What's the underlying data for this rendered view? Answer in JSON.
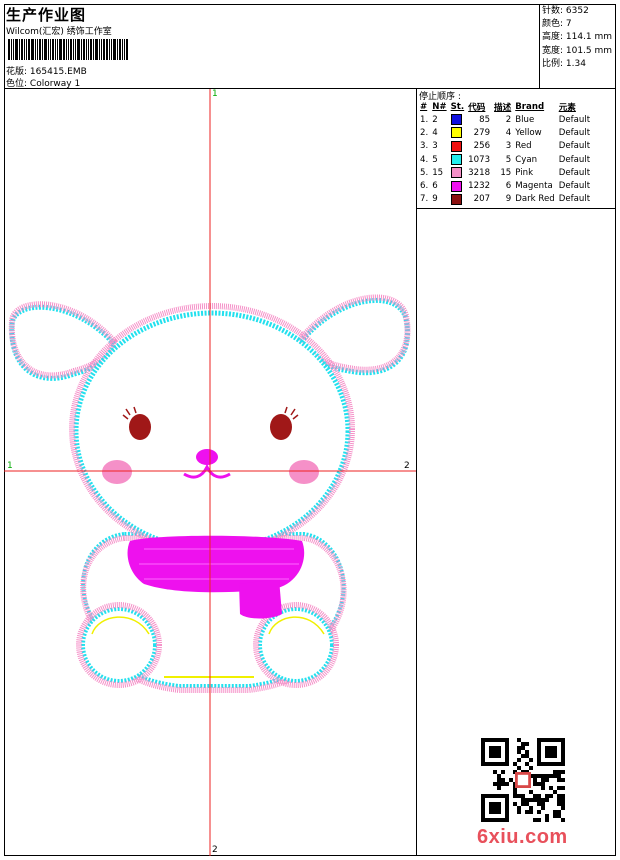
{
  "header": {
    "title": "生产作业图",
    "subtitle": "Wilcom(汇宏) 绣饰工作室",
    "design_label": "花版:",
    "design_value": "165415.EMB",
    "color_label": "色位:",
    "color_value": "Colorway 1"
  },
  "stats": {
    "stitches": "针数: 6352",
    "colors": "颜色: 7",
    "height": "高度: 114.1 mm",
    "width": "宽度: 101.5 mm",
    "scale": "比例: 1.34"
  },
  "sequence": {
    "heading": "停止顺序 :",
    "columns": [
      "#",
      "N#",
      "St.",
      "代码",
      "描述",
      "Brand",
      "元素"
    ],
    "rows": [
      {
        "idx": "1.",
        "n": "2",
        "color": "#1010e0",
        "st": "85",
        "code": "2",
        "desc": "Blue",
        "brand": "Default"
      },
      {
        "idx": "2.",
        "n": "4",
        "color": "#ffff00",
        "st": "279",
        "code": "4",
        "desc": "Yellow",
        "brand": "Default"
      },
      {
        "idx": "3.",
        "n": "3",
        "color": "#ee1111",
        "st": "256",
        "code": "3",
        "desc": "Red",
        "brand": "Default"
      },
      {
        "idx": "4.",
        "n": "5",
        "color": "#22eeee",
        "st": "1073",
        "code": "5",
        "desc": "Cyan",
        "brand": "Default"
      },
      {
        "idx": "5.",
        "n": "15",
        "color": "#f590c8",
        "st": "3218",
        "code": "15",
        "desc": "Pink",
        "brand": "Default"
      },
      {
        "idx": "6.",
        "n": "6",
        "color": "#ee11ee",
        "st": "1232",
        "code": "6",
        "desc": "Magenta",
        "brand": "Default"
      },
      {
        "idx": "7.",
        "n": "9",
        "color": "#8b1010",
        "st": "207",
        "code": "9",
        "desc": "Dark Red",
        "brand": "Default"
      }
    ]
  },
  "axis_labels": {
    "top": "1",
    "bottom": "2",
    "left": "1",
    "right": "2"
  },
  "colors": {
    "pink": "#f590c8",
    "cyan": "#22e0ee",
    "magenta": "#ee11ee",
    "dark_red": "#a01818",
    "yellow": "#f0f000",
    "axis": "#ee2222"
  },
  "watermark": "6xiu.com"
}
